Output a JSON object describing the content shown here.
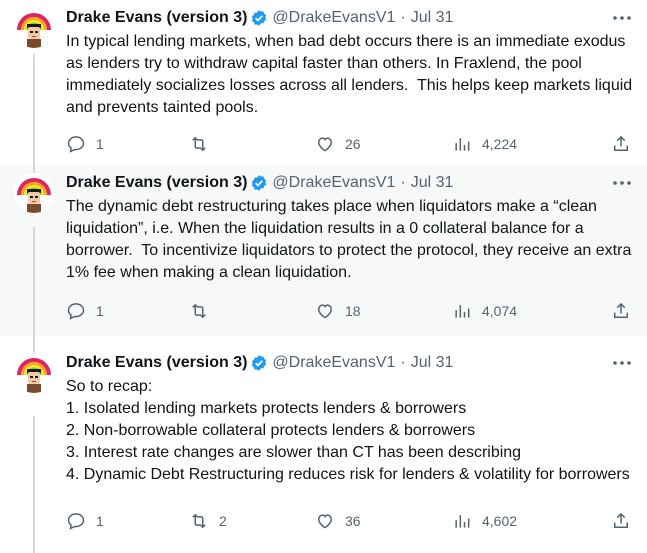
{
  "tweets": [
    {
      "name": "Drake Evans (version 3)",
      "handle": "@DrakeEvansV1",
      "separator": "·",
      "date": "Jul 31",
      "text": "In typical lending markets, when bad debt occurs there is an immediate exodus as lenders try to withdraw capital faster than others. In Fraxlend, the pool immediately socializes losses across all lenders.  This helps keep markets liquid and prevents tainted pools.",
      "replies": "1",
      "retweets": "",
      "likes": "26",
      "views": "4,224"
    },
    {
      "name": "Drake Evans (version 3)",
      "handle": "@DrakeEvansV1",
      "separator": "·",
      "date": "Jul 31",
      "text": "The dynamic debt restructuring takes place when liquidators make a “clean liquidation”, i.e. When the liquidation results in a 0 collateral balance for a borrower.  To incentivize liquidators to protect the protocol, they receive an extra 1% fee when making a clean liquidation.",
      "replies": "1",
      "retweets": "",
      "likes": "18",
      "views": "4,074"
    },
    {
      "name": "Drake Evans (version 3)",
      "handle": "@DrakeEvansV1",
      "separator": "·",
      "date": "Jul 31",
      "text": "So to recap:\n1. Isolated lending markets protects lenders & borrowers\n2. Non-borrowable collateral protects lenders & borrowers\n3. Interest rate changes are slower than CT has been describing\n4. Dynamic Debt Restructuring reduces risk for lenders & volatility for borrowers",
      "replies": "1",
      "retweets": "2",
      "likes": "36",
      "views": "4,602"
    }
  ],
  "colors": {
    "text": "#0f1419",
    "muted": "#536471",
    "verified": "#1d9bf0",
    "highlight_bg": "#f7f9f9",
    "thread_line": "#cfd9de"
  },
  "icons": {
    "verified": "verified-badge-icon",
    "more": "more-icon",
    "reply": "reply-icon",
    "retweet": "retweet-icon",
    "like": "like-icon",
    "views": "views-icon",
    "share": "share-icon"
  }
}
